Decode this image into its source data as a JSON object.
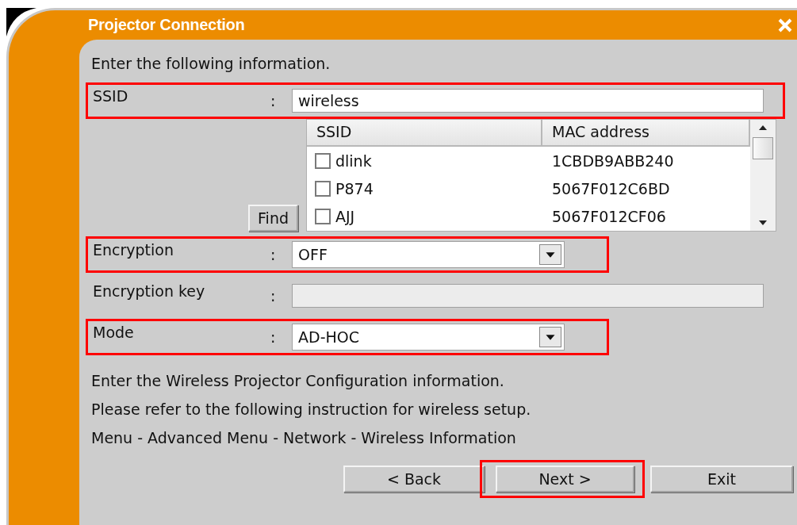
{
  "window": {
    "title": "Projector Connection"
  },
  "intro": "Enter the following information.",
  "fields": [
    {
      "kind": "text",
      "label": "SSID",
      "colon": ":",
      "value": "wireless",
      "highlighted": true,
      "disabled": false
    },
    {
      "kind": "list",
      "button": "Find",
      "columns": [
        "SSID",
        "MAC address"
      ],
      "rows": [
        {
          "ssid": "dlink",
          "mac": "1CBDB9ABB240",
          "checked": false
        },
        {
          "ssid": "P874",
          "mac": "5067F012C6BD",
          "checked": false
        },
        {
          "ssid": "AJJ",
          "mac": "5067F012CF06",
          "checked": false
        }
      ]
    },
    {
      "kind": "select",
      "label": "Encryption",
      "colon": ":",
      "value": "OFF",
      "highlighted": true
    },
    {
      "kind": "text",
      "label": "Encryption key",
      "colon": ":",
      "highlighted": false,
      "disabled": true
    },
    {
      "kind": "select",
      "label": "Mode",
      "colon": ":",
      "value": "AD-HOC",
      "highlighted": true
    }
  ],
  "notes": [
    "Enter the Wireless Projector Configuration information.",
    "Please refer to the following instruction for wireless setup.",
    "Menu - Advanced Menu - Network - Wireless Information"
  ],
  "buttons": [
    {
      "label": "< Back",
      "highlighted": false
    },
    {
      "label": "Next >",
      "highlighted": true
    },
    {
      "label": "Exit",
      "highlighted": false
    }
  ]
}
